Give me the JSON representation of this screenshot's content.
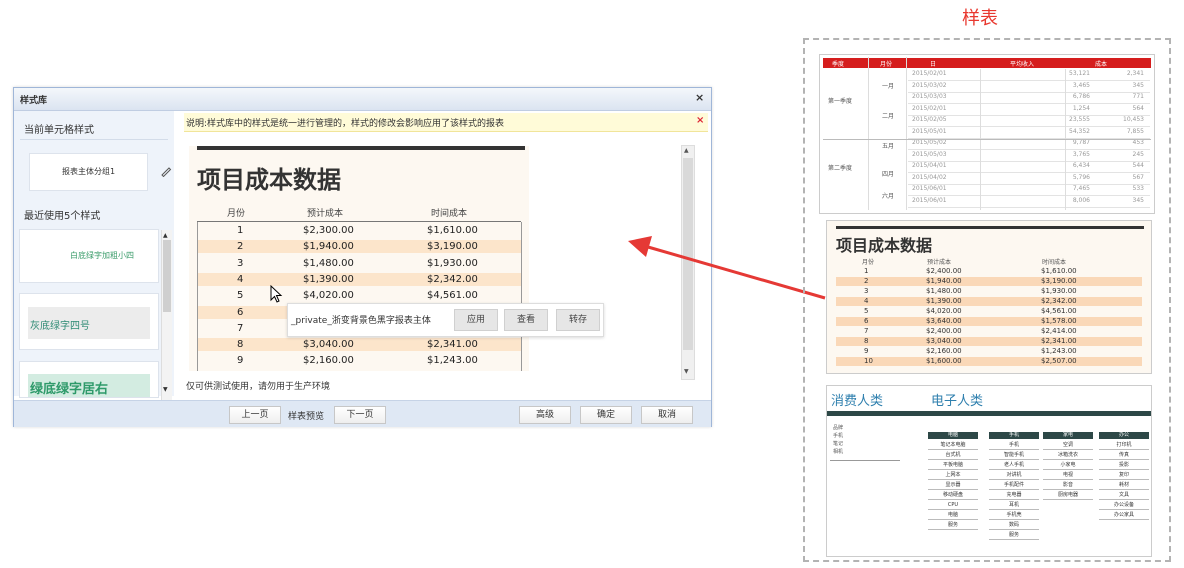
{
  "dialog": {
    "title": "样式库",
    "close": "×",
    "current_style_section": "当前单元格样式",
    "current_style_name": "报表主体分组1",
    "recent_section": "最近使用5个样式",
    "recent_styles": [
      "白底绿字加粗小四",
      "灰底绿字四号",
      "绿底绿字居右"
    ],
    "notice": "说明:样式库中的样式是统一进行管理的，样式的修改会影响应用了该样式的报表",
    "notice_close": "×",
    "preview": {
      "title": "项目成本数据",
      "columns": [
        "月份",
        "预计成本",
        "时间成本"
      ],
      "rows": [
        [
          "1",
          "$2,300.00",
          "$1,610.00"
        ],
        [
          "2",
          "$1,940.00",
          "$3,190.00"
        ],
        [
          "3",
          "$1,480.00",
          "$1,930.00"
        ],
        [
          "4",
          "$1,390.00",
          "$2,342.00"
        ],
        [
          "5",
          "$4,020.00",
          "$4,561.00"
        ],
        [
          "6",
          "",
          ""
        ],
        [
          "7",
          "",
          ""
        ],
        [
          "8",
          "$3,040.00",
          "$2,341.00"
        ],
        [
          "9",
          "$2,160.00",
          "$1,243.00"
        ]
      ]
    },
    "popup": {
      "style_name": "_private_浙变背景色黑字报表主体",
      "apply": "应用",
      "view": "查看",
      "save_as": "转存"
    },
    "footnote": "仅可供测试使用，请勿用于生产环境",
    "prev": "上一页",
    "page_label": "样表预览",
    "next": "下一页",
    "advanced": "高级",
    "ok": "确定",
    "cancel": "取消"
  },
  "samples": {
    "title": "样表",
    "sample1": {
      "headers": [
        "季度",
        "月份",
        "日",
        "平均收入",
        "成本"
      ],
      "quarters": [
        "第一季度",
        "第二季度"
      ],
      "months": [
        "一月",
        "二月",
        "五月",
        "四月",
        "六月"
      ],
      "rows": [
        [
          "2015/02/01",
          "53,121",
          "2,341"
        ],
        [
          "2015/03/02",
          "3,465",
          "345"
        ],
        [
          "2015/03/03",
          "6,786",
          "771"
        ],
        [
          "2015/02/01",
          "1,254",
          "564"
        ],
        [
          "2015/02/05",
          "23,555",
          "10,453"
        ],
        [
          "2015/05/01",
          "54,352",
          "7,855"
        ],
        [
          "2015/05/02",
          "9,787",
          "453"
        ],
        [
          "2015/05/03",
          "3,765",
          "245"
        ],
        [
          "2015/04/01",
          "6,434",
          "544"
        ],
        [
          "2015/04/02",
          "5,796",
          "567"
        ],
        [
          "2015/06/01",
          "7,465",
          "533"
        ],
        [
          "2015/06/01",
          "8,006",
          "345"
        ]
      ]
    },
    "sample2": {
      "title": "项目成本数据",
      "columns": [
        "月份",
        "预计成本",
        "时间成本"
      ],
      "rows": [
        [
          "1",
          "$2,400.00",
          "$1,610.00"
        ],
        [
          "2",
          "$1,940.00",
          "$3,190.00"
        ],
        [
          "3",
          "$1,480.00",
          "$1,930.00"
        ],
        [
          "4",
          "$1,390.00",
          "$2,342.00"
        ],
        [
          "5",
          "$4,020.00",
          "$4,561.00"
        ],
        [
          "6",
          "$3,640.00",
          "$1,578.00"
        ],
        [
          "7",
          "$2,400.00",
          "$2,414.00"
        ],
        [
          "8",
          "$3,040.00",
          "$2,341.00"
        ],
        [
          "9",
          "$2,160.00",
          "$1,243.00"
        ],
        [
          "10",
          "$1,600.00",
          "$2,507.00"
        ]
      ]
    },
    "sample3": {
      "left_title": "消费人类",
      "right_title": "电子人类",
      "side_items": [
        "品牌",
        "手机",
        "笔记",
        "相机"
      ],
      "columns": [
        {
          "header": "电脑",
          "items": [
            "笔记本电脑",
            "台式机",
            "平板电脑",
            "上网本",
            "显示器",
            "移动硬盘",
            "CPU",
            "电脑",
            "服务"
          ]
        },
        {
          "header": "手机",
          "items": [
            "手机",
            "智能手机",
            "老人手机",
            "对讲机",
            "手机配件",
            "充电器",
            "耳机",
            "手机壳",
            "数码",
            "服务"
          ]
        },
        {
          "header": "家电",
          "items": [
            "空调",
            "冰箱洗衣",
            "小家电",
            "电视",
            "影音",
            "厨房电器"
          ]
        },
        {
          "header": "办公",
          "items": [
            "打印机",
            "传真",
            "投影",
            "复印",
            "耗材",
            "文具",
            "办公设备",
            "办公家具"
          ]
        }
      ]
    }
  }
}
